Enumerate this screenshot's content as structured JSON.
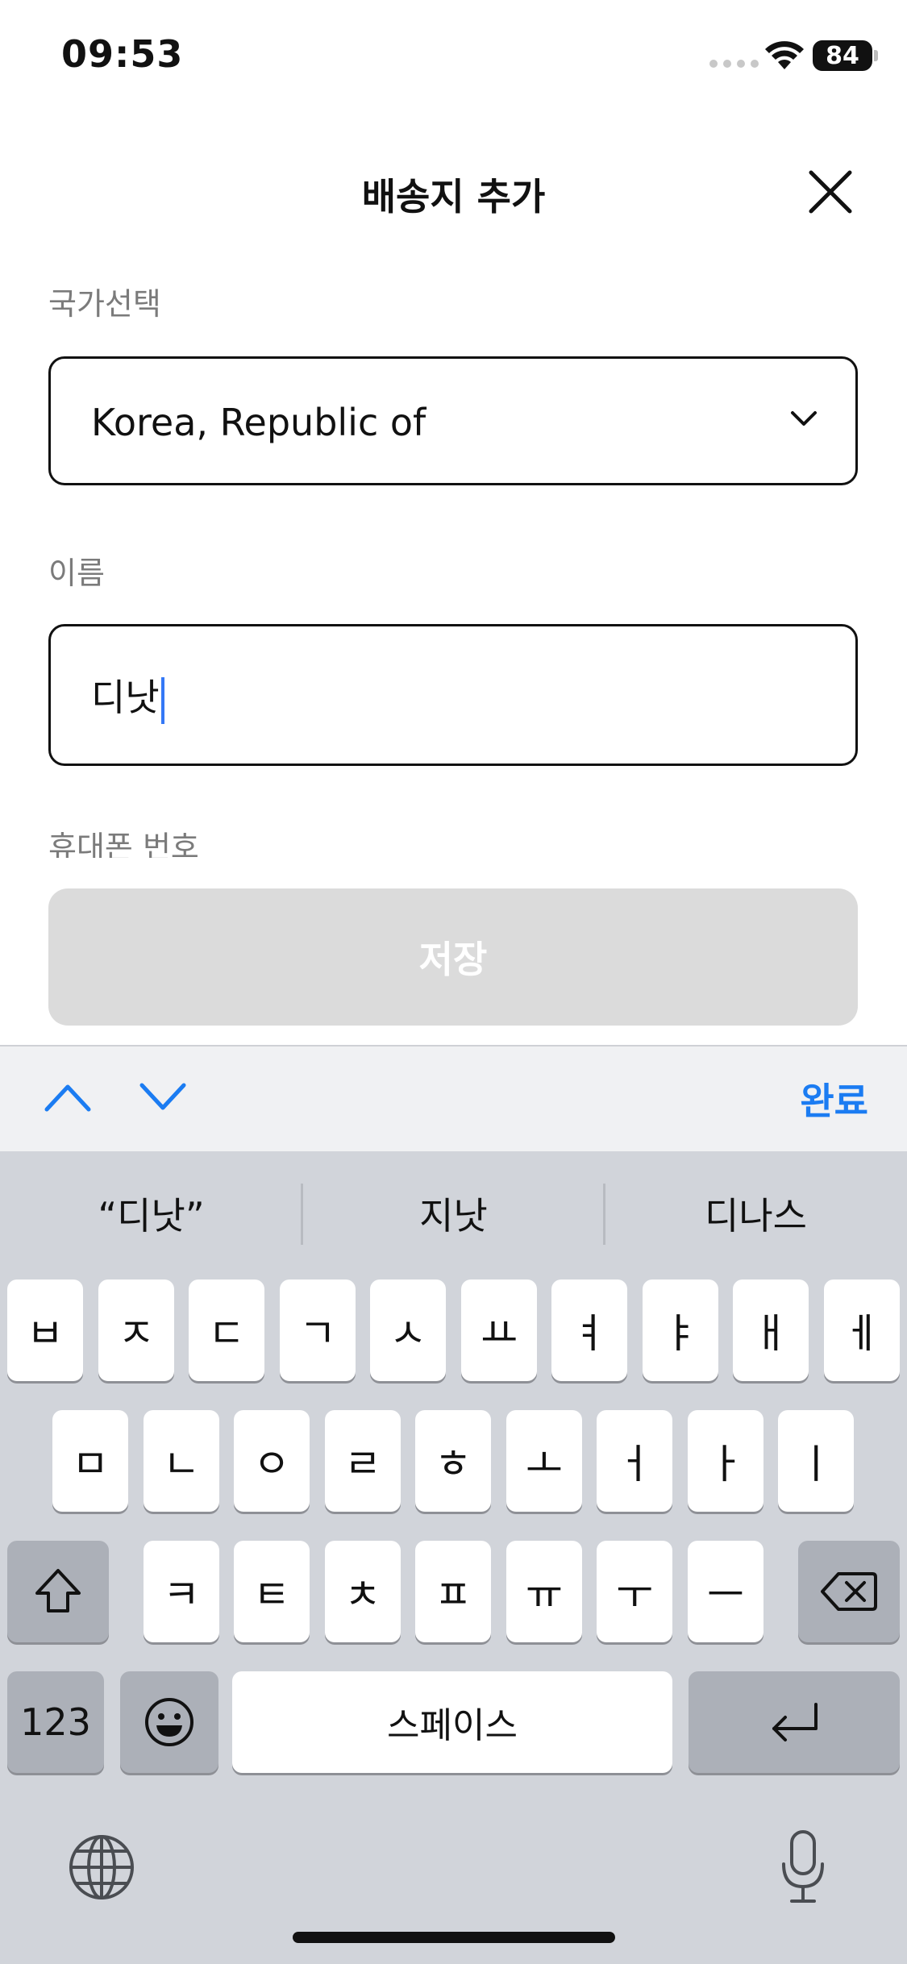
{
  "status_bar": {
    "time": "09:53",
    "battery": "84"
  },
  "header": {
    "title": "배송지 추가"
  },
  "form": {
    "country_label": "국가선택",
    "country_value": "Korea, Republic of",
    "name_label": "이름",
    "name_value": "디낫",
    "phone_label": "휴대폰 번호",
    "save_label": "저장"
  },
  "accessory": {
    "done_label": "완료"
  },
  "keyboard": {
    "suggestions": [
      "“디낫”",
      "지낫",
      "디나스"
    ],
    "row1": [
      "ㅂ",
      "ㅈ",
      "ㄷ",
      "ㄱ",
      "ㅅ",
      "ㅛ",
      "ㅕ",
      "ㅑ",
      "ㅐ",
      "ㅔ"
    ],
    "row2": [
      "ㅁ",
      "ㄴ",
      "ㅇ",
      "ㄹ",
      "ㅎ",
      "ㅗ",
      "ㅓ",
      "ㅏ",
      "ㅣ"
    ],
    "row3": [
      "ㅋ",
      "ㅌ",
      "ㅊ",
      "ㅍ",
      "ㅠ",
      "ㅜ",
      "ㅡ"
    ],
    "numbers_label": "123",
    "space_label": "스페이스"
  },
  "colors": {
    "accent": "#1b7cf2",
    "caret": "#3478f6",
    "disabled_button": "#dbdbdb",
    "keyboard_bg": "#d1d4da"
  },
  "icons": [
    "wifi-icon",
    "close-icon",
    "chevron-down-icon",
    "chevron-up-icon",
    "shift-icon",
    "delete-icon",
    "emoji-icon",
    "return-icon",
    "globe-icon",
    "mic-icon"
  ]
}
